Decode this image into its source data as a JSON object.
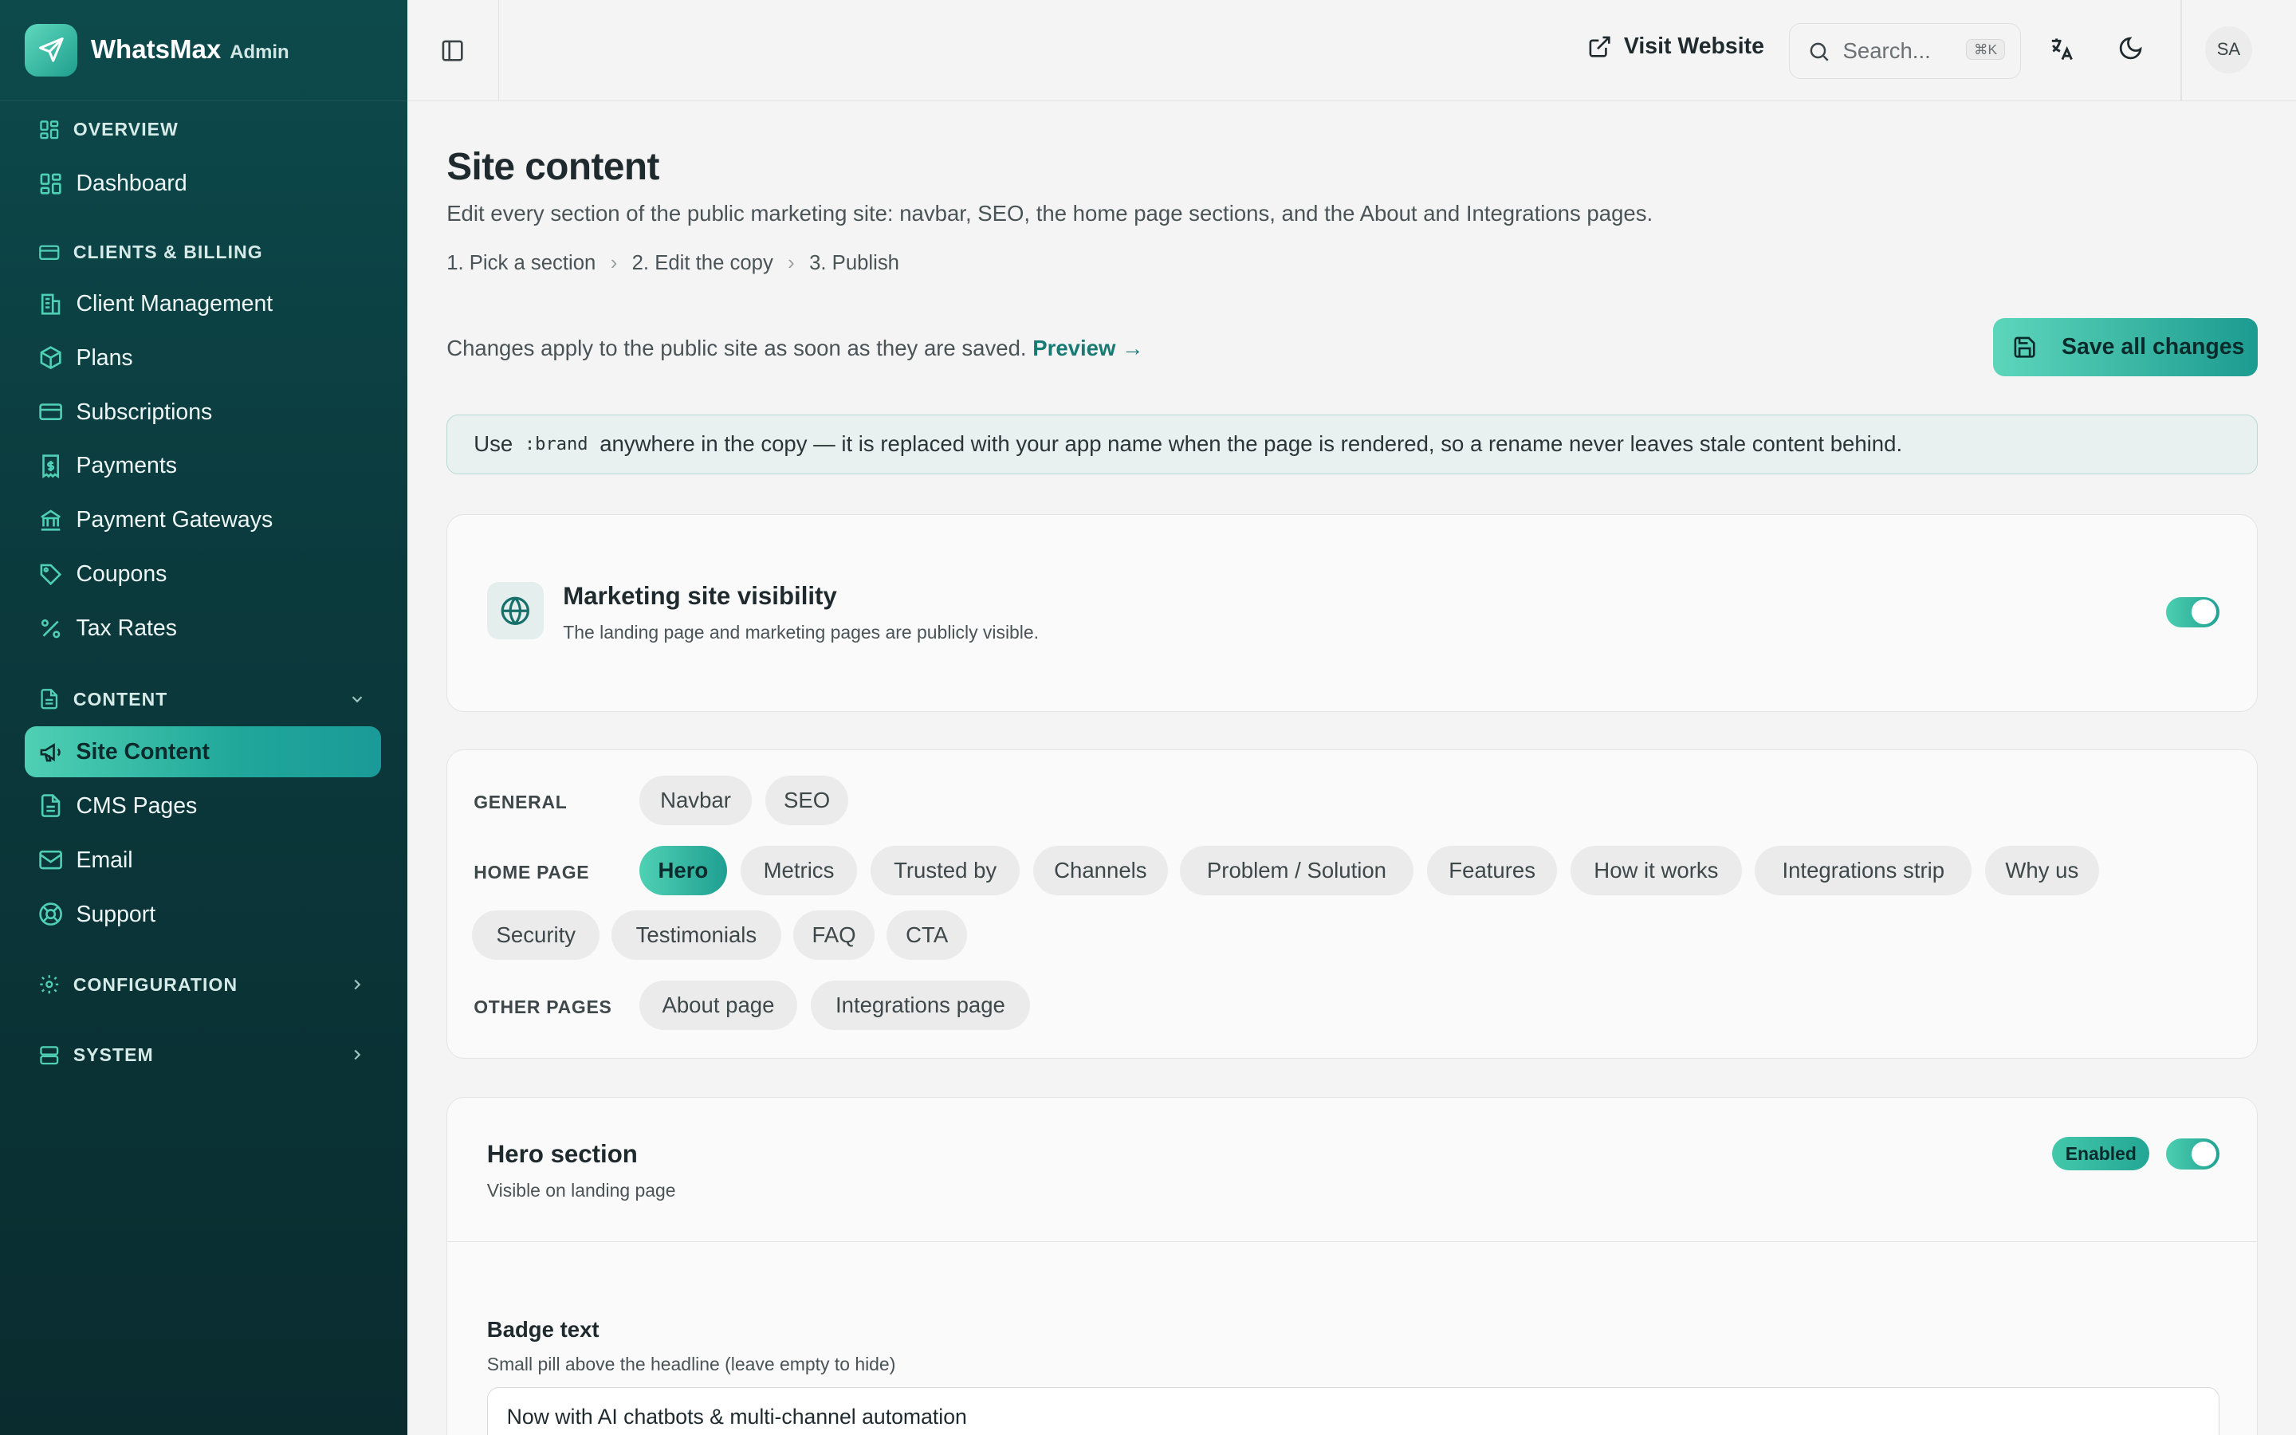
{
  "brand": {
    "name": "WhatsMax",
    "sub": "Admin"
  },
  "sidebar": {
    "sections": {
      "overview": "OVERVIEW",
      "clients_billing": "CLIENTS & BILLING",
      "content": "CONTENT",
      "configuration": "CONFIGURATION",
      "system": "SYSTEM"
    },
    "items": {
      "dashboard": "Dashboard",
      "client_management": "Client Management",
      "plans": "Plans",
      "subscriptions": "Subscriptions",
      "payments": "Payments",
      "payment_gateways": "Payment Gateways",
      "coupons": "Coupons",
      "tax_rates": "Tax Rates",
      "site_content": "Site Content",
      "cms_pages": "CMS Pages",
      "email": "Email",
      "support": "Support"
    }
  },
  "header": {
    "visit_website": "Visit Website",
    "search_placeholder": "Search...",
    "search_shortcut": "⌘K",
    "avatar_initials": "SA"
  },
  "page": {
    "title": "Site content",
    "description": "Edit every section of the public marketing site: navbar, SEO, the home page sections, and the About and Integrations pages.",
    "steps": [
      "1.  Pick a section",
      "2.  Edit the copy",
      "3.  Publish"
    ],
    "note": "Changes apply to the public site as soon as they are saved.",
    "preview_link": "Preview →",
    "save_button": "Save all changes",
    "info": {
      "prefix": "Use",
      "token": ":brand",
      "suffix": "anywhere in the copy — it is replaced with your app name when the page is rendered, so a rename never leaves stale content behind."
    }
  },
  "visibility": {
    "title": "Marketing site visibility",
    "subtitle": "The landing page and marketing pages are publicly visible.",
    "enabled": true
  },
  "tabs": {
    "general_label": "GENERAL",
    "general": [
      "Navbar",
      "SEO"
    ],
    "home_label": "HOME PAGE",
    "home": [
      "Hero",
      "Metrics",
      "Trusted by",
      "Channels",
      "Problem / Solution",
      "Features",
      "How it works",
      "Integrations strip",
      "Why us",
      "Security",
      "Testimonials",
      "FAQ",
      "CTA"
    ],
    "other_label": "OTHER PAGES",
    "other": [
      "About page",
      "Integrations page"
    ],
    "active": "Hero"
  },
  "hero": {
    "title": "Hero section",
    "subtitle": "Visible on landing page",
    "badge": "Enabled",
    "enabled": true,
    "badge_field": {
      "label": "Badge text",
      "help": "Small pill above the headline (leave empty to hide)",
      "value": "Now with AI chatbots & multi-channel automation"
    }
  },
  "colors": {
    "accent": "#1f9e8e",
    "sidebar_bg": "#0b3a3d"
  }
}
